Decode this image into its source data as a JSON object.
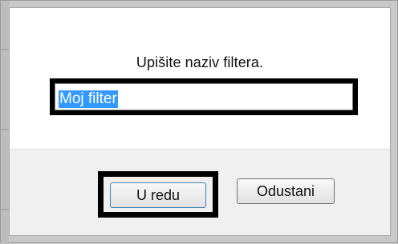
{
  "dialog": {
    "prompt": "Upišite naziv filtera.",
    "input_value": "Moj filter",
    "ok_label": "U redu",
    "cancel_label": "Odustani"
  },
  "colors": {
    "selection": "#3399ff",
    "dialog_bg": "#ffffff",
    "footer_bg": "#f0f0f0",
    "highlight_border": "#000000"
  }
}
